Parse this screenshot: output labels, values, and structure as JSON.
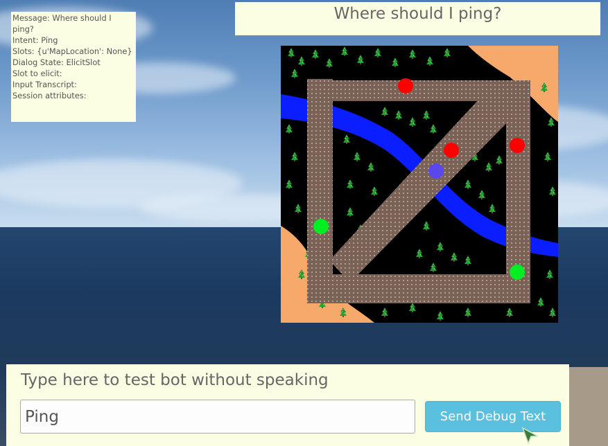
{
  "debug": {
    "message": "Message: Where should I ping?",
    "intent": "Intent: Ping",
    "slots": "Slots: {u'MapLocation': None}",
    "dialog_state": "Dialog State: ElicitSlot",
    "slot_to_elicit": "Slot to elicit:",
    "input_transcript": "Input Transcript:",
    "session_attributes": "Session attributes:"
  },
  "prompt": "Where should I ping?",
  "input_panel": {
    "hint": "Type here to test bot without speaking",
    "value": "Ping",
    "send_label": "Send Debug Text"
  },
  "map": {
    "markers": [
      {
        "color": "red",
        "team": "enemy"
      },
      {
        "color": "red",
        "team": "enemy"
      },
      {
        "color": "red",
        "team": "enemy"
      },
      {
        "color": "blue",
        "team": "player"
      },
      {
        "color": "green",
        "team": "ally"
      },
      {
        "color": "green",
        "team": "ally"
      }
    ]
  },
  "colors": {
    "panel": "#fcfee3",
    "button": "#5bc0de",
    "sand": "#f6a96a",
    "river": "#0a1eff",
    "path": "#7a6356",
    "enemy": "#ff0000",
    "ally": "#00ee22",
    "player": "#5a47ee"
  }
}
